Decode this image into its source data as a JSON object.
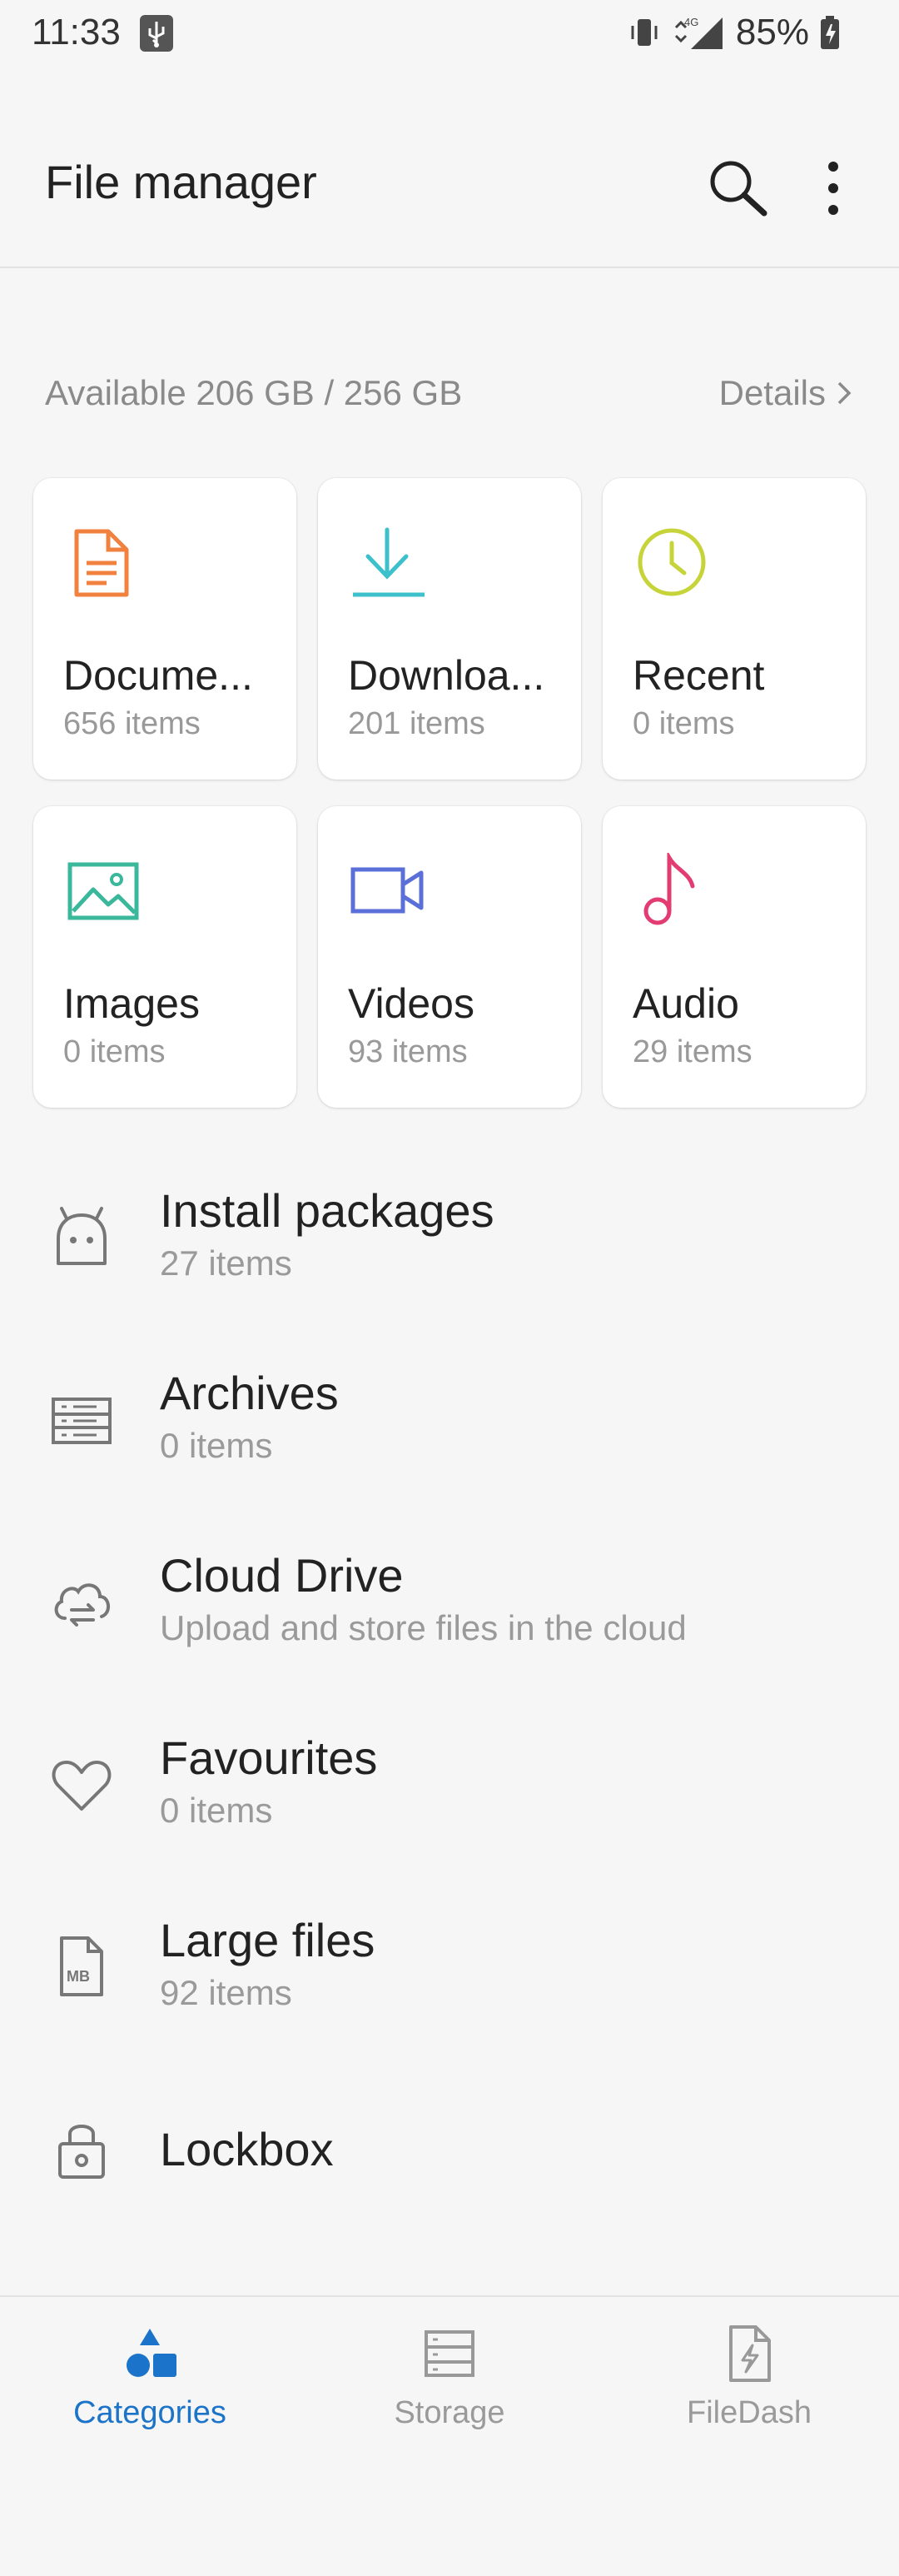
{
  "status_bar": {
    "time": "11:33",
    "network": "4G",
    "battery_percent": "85%"
  },
  "app_bar": {
    "title": "File manager"
  },
  "storage": {
    "available_text": "Available 206 GB / 256 GB",
    "details_label": "Details"
  },
  "categories": [
    {
      "name": "Docume...",
      "count": "656 items",
      "icon": "document-icon",
      "color": "#f0813f"
    },
    {
      "name": "Downloa...",
      "count": "201 items",
      "icon": "download-icon",
      "color": "#3cc0cc"
    },
    {
      "name": "Recent",
      "count": "0 items",
      "icon": "clock-icon",
      "color": "#c6d43a"
    },
    {
      "name": "Images",
      "count": "0 items",
      "icon": "image-icon",
      "color": "#3bb89c"
    },
    {
      "name": "Videos",
      "count": "93 items",
      "icon": "video-icon",
      "color": "#5b6fd8"
    },
    {
      "name": "Audio",
      "count": "29 items",
      "icon": "music-note-icon",
      "color": "#e23c72"
    }
  ],
  "list_items": [
    {
      "title": "Install packages",
      "subtitle": "27 items",
      "icon": "android-icon"
    },
    {
      "title": "Archives",
      "subtitle": "0 items",
      "icon": "archive-icon"
    },
    {
      "title": "Cloud Drive",
      "subtitle": "Upload and store files in the cloud",
      "icon": "cloud-sync-icon"
    },
    {
      "title": "Favourites",
      "subtitle": "0 items",
      "icon": "heart-icon"
    },
    {
      "title": "Large files",
      "subtitle": "92 items",
      "icon": "mb-file-icon"
    },
    {
      "title": "Lockbox",
      "subtitle": "",
      "icon": "lock-icon"
    }
  ],
  "bottom_nav": {
    "tabs": [
      {
        "label": "Categories",
        "active": true,
        "icon": "categories-icon"
      },
      {
        "label": "Storage",
        "active": false,
        "icon": "storage-icon"
      },
      {
        "label": "FileDash",
        "active": false,
        "icon": "filedash-icon"
      }
    ]
  },
  "colors": {
    "accent": "#1b74c9",
    "background": "#f6f6f6",
    "card": "#ffffff",
    "secondary_text": "#999999"
  }
}
